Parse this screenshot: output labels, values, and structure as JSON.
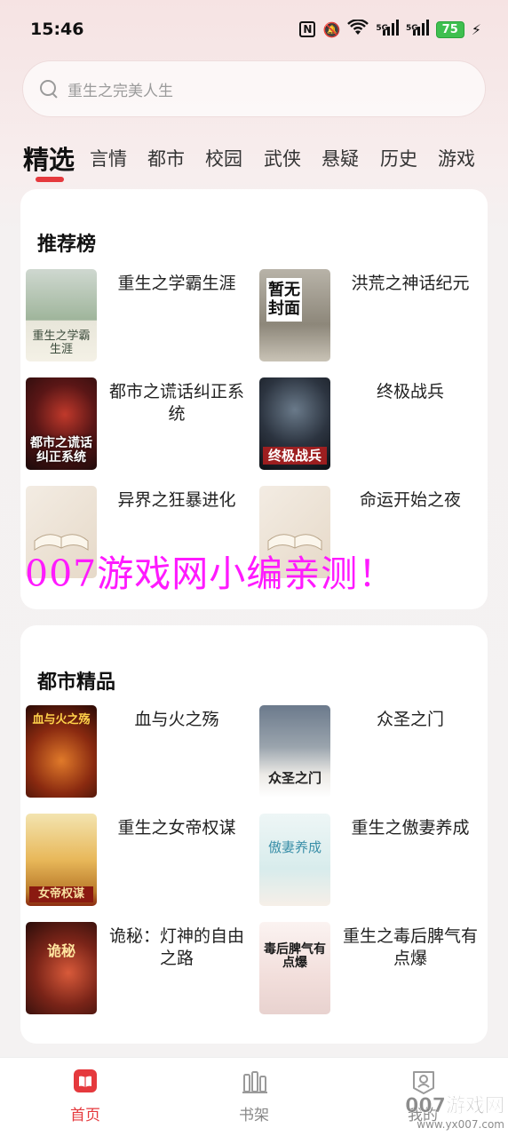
{
  "status_bar": {
    "time": "15:46",
    "battery": "75",
    "signal_1": "5G",
    "signal_2": "5G"
  },
  "search": {
    "placeholder": "重生之完美人生"
  },
  "tabs": [
    "精选",
    "言情",
    "都市",
    "校园",
    "武侠",
    "悬疑",
    "历史",
    "游戏"
  ],
  "sections": [
    {
      "title": "推荐榜",
      "books": [
        {
          "title": "重生之学霸生涯",
          "cover_text": "重生之学霸生涯"
        },
        {
          "title": "洪荒之神话纪元",
          "cover_text": "暂无封面"
        },
        {
          "title": "都市之谎话纠正系统",
          "cover_text": "都市之谎话纠正系统"
        },
        {
          "title": "终极战兵",
          "cover_text": "终极战兵"
        },
        {
          "title": "异界之狂暴进化",
          "cover_text": ""
        },
        {
          "title": "命运开始之夜",
          "cover_text": ""
        }
      ]
    },
    {
      "title": "都市精品",
      "books": [
        {
          "title": "血与火之殇",
          "cover_text": "血与火之殇"
        },
        {
          "title": "众圣之门",
          "cover_text": "众圣之门"
        },
        {
          "title": "重生之女帝权谋",
          "cover_text": "女帝权谋"
        },
        {
          "title": "重生之傲妻养成",
          "cover_text": "傲妻养成"
        },
        {
          "title": "诡秘：灯神的自由之路",
          "cover_text": "诡秘"
        },
        {
          "title": "重生之毒后脾气有点爆",
          "cover_text": "毒后脾气有点爆"
        }
      ]
    }
  ],
  "watermark": {
    "main": "007游戏网小编亲测！",
    "corner_big": "007游戏网",
    "corner_small": "www.yx007.com"
  },
  "bottom_nav": [
    {
      "label": "首页",
      "icon": "book-open-icon",
      "active": true
    },
    {
      "label": "书架",
      "icon": "bookshelf-icon",
      "active": false
    },
    {
      "label": "我的",
      "icon": "profile-icon",
      "active": false
    }
  ],
  "colors": {
    "accent": "#e5393d",
    "watermark": "#ff1aff"
  }
}
